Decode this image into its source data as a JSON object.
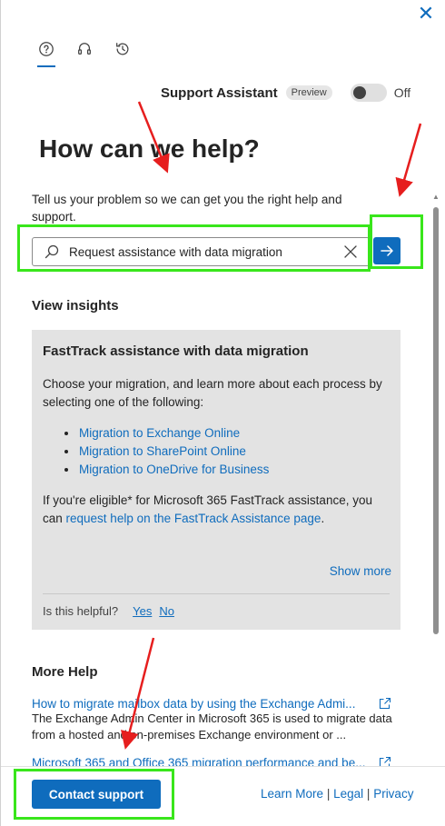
{
  "window": {
    "close_label": "✕"
  },
  "tabs": [
    {
      "name": "help",
      "icon": "question-circle-icon"
    },
    {
      "name": "support",
      "icon": "headset-icon"
    },
    {
      "name": "history",
      "icon": "history-icon"
    }
  ],
  "assistant": {
    "label": "Support Assistant",
    "badge": "Preview",
    "toggle_state": "Off"
  },
  "heading": "How can we help?",
  "intro": "Tell us your problem so we can get you the right help and support.",
  "search": {
    "value": "Request assistance with data migration",
    "placeholder": ""
  },
  "insights": {
    "title": "View insights",
    "card": {
      "title": "FastTrack assistance with data migration",
      "description": "Choose your migration, and learn more about each process by selecting one of the following:",
      "links": [
        "Migration to Exchange Online",
        "Migration to SharePoint Online",
        "Migration to OneDrive for Business"
      ],
      "eligible_prefix": "If you're eligible* for Microsoft 365 FastTrack assistance, you can ",
      "eligible_link": "request help on the FastTrack Assistance page",
      "eligible_suffix": ".",
      "show_more": "Show more",
      "helpful_question": "Is this helpful?",
      "helpful_yes": "Yes",
      "helpful_no": "No"
    }
  },
  "more_help": {
    "title": "More Help",
    "items": [
      {
        "link": "How to migrate mailbox data by using the Exchange Admi...",
        "desc": "The Exchange Admin Center in Microsoft 365 is used to migrate data from a hosted and on-premises Exchange environment or ..."
      },
      {
        "link": "Microsoft 365 and Office 365 migration performance and be...",
        "desc": ""
      }
    ]
  },
  "footer": {
    "contact_label": "Contact support",
    "learn_more": "Learn More",
    "legal": "Legal",
    "privacy": "Privacy",
    "separator": "|"
  },
  "colors": {
    "accent": "#0f6cbd",
    "highlight": "#39e61b",
    "arrow": "#e61e1e",
    "card_bg": "#e3e3e3"
  }
}
